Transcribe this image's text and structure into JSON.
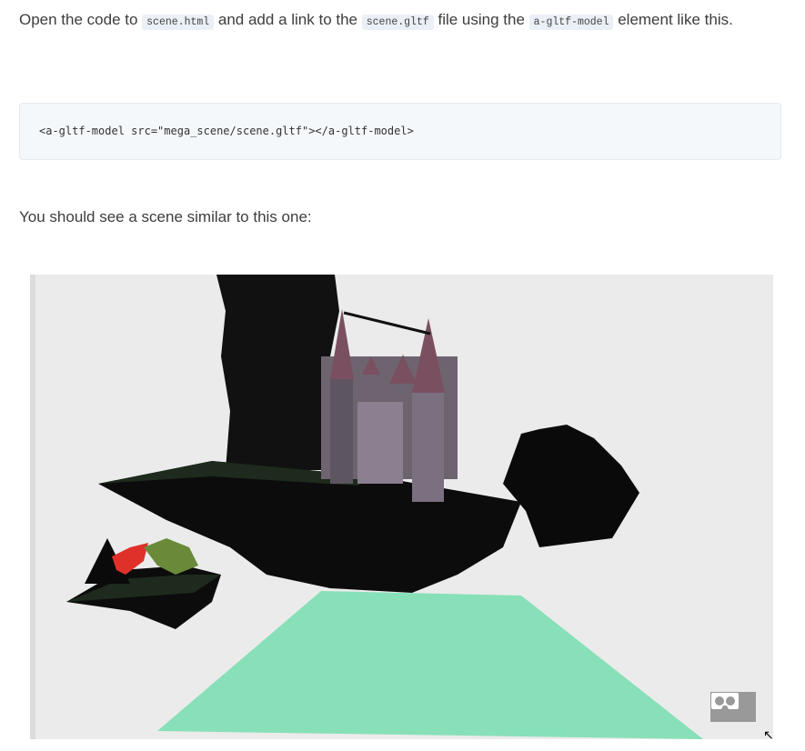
{
  "intro": {
    "t1": "Open the code to ",
    "c1": "scene.html",
    "t2": " and add a link to the ",
    "c2": "scene.gltf",
    "t3": " file using the ",
    "c3": "a-gltf-model",
    "t4": " element like this."
  },
  "code_block": "<a-gltf-model src=\"mega_scene/scene.gltf\"></a-gltf-model>",
  "followup": "You should see a scene similar to this one:",
  "scene": {
    "ground_color": "#88e0b8",
    "background_color": "#ebebeb",
    "vr_button_icon": "vr-headset-icon"
  }
}
